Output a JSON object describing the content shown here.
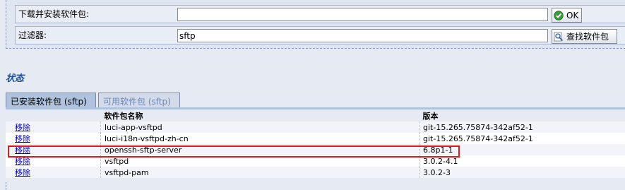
{
  "install": {
    "label": "下载并安装软件包:",
    "value": "",
    "ok_label": "OK"
  },
  "filter": {
    "label": "过滤器:",
    "value": "sftp",
    "find_label": "查找软件包"
  },
  "status_title": "状态",
  "tabs": [
    {
      "label": "已安装软件包 (sftp)",
      "active": true
    },
    {
      "label": "可用软件包 (sftp)",
      "active": false
    }
  ],
  "table": {
    "headers": {
      "action": "",
      "name": "软件包名称",
      "version": "版本"
    },
    "rows": [
      {
        "action": "移除",
        "name": "luci-app-vsftpd",
        "version": "git-15.265.75874-342af52-1"
      },
      {
        "action": "移除",
        "name": "luci-i18n-vsftpd-zh-cn",
        "version": "git-15.265.75874-342af52-1"
      },
      {
        "action": "移除",
        "name": "openssh-sftp-server",
        "version": "6.8p1-1"
      },
      {
        "action": "移除",
        "name": "vsftpd",
        "version": "3.0.2-4.1"
      },
      {
        "action": "移除",
        "name": "vsftpd-pam",
        "version": "3.0.2-3"
      }
    ]
  },
  "colors": {
    "highlight": "#e01a1a",
    "link": "#0000cc",
    "accent": "#1f4f8f"
  },
  "icons": {
    "ok": "check-circle-icon",
    "find": "magnifier-icon"
  }
}
